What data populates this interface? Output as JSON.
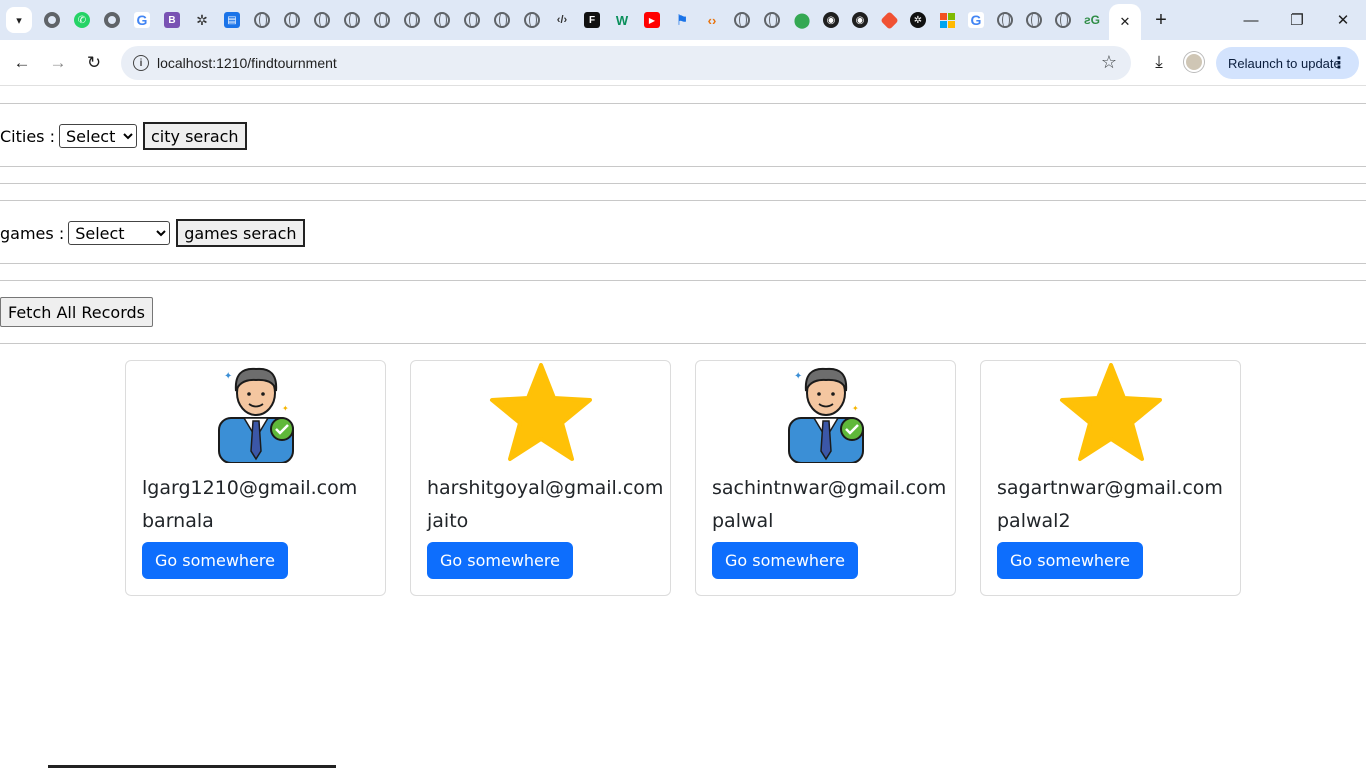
{
  "browser": {
    "address": "localhost:1210/findtournment",
    "relaunch_label": "Relaunch to update",
    "close_tab": "✕",
    "new_tab": "+",
    "minimize": "—",
    "restore": "❐",
    "close_window": "✕"
  },
  "filters": {
    "cities_label": "Cities :",
    "cities_selected": "Select",
    "city_button": "city serach",
    "games_label": "games :",
    "games_selected": "Select",
    "games_button": "games serach",
    "fetch_button": "Fetch All Records"
  },
  "cards": [
    {
      "email": "lgarg1210@gmail.com",
      "city": "barnala",
      "button": "Go somewhere",
      "icon": "businessman-icon"
    },
    {
      "email": "harshitgoyal@gmail.com",
      "city": "jaito",
      "button": "Go somewhere",
      "icon": "star-icon"
    },
    {
      "email": "sachintnwar@gmail.com",
      "city": "palwal",
      "button": "Go somewhere",
      "icon": "businessman-icon"
    },
    {
      "email": "sagartnwar@gmail.com",
      "city": "palwal2",
      "button": "Go somewhere",
      "icon": "star-icon"
    }
  ],
  "colors": {
    "primary_button": "#0d6efd",
    "star": "#ffc107",
    "tabstrip": "#dfe8f6",
    "relaunch_bg": "#d3e3fd"
  }
}
